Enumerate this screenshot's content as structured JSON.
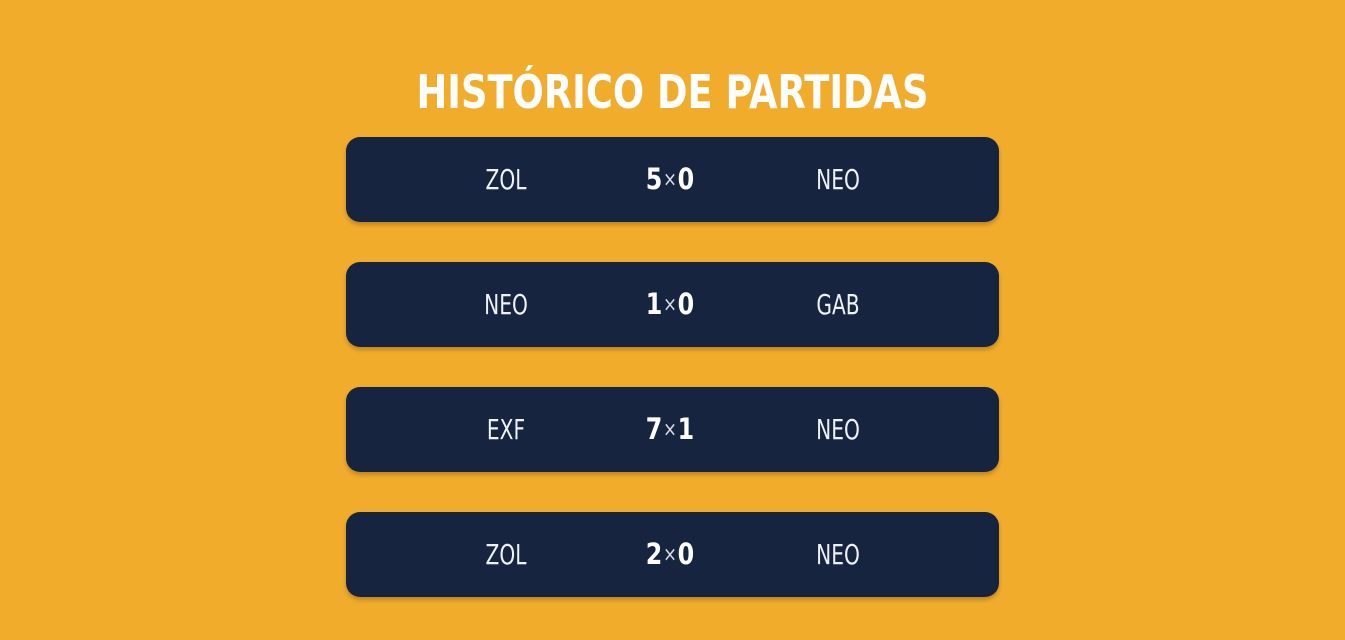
{
  "page": {
    "title": "HISTÓRICO DE PARTIDAS"
  },
  "colors": {
    "background": "#F2AC2C",
    "card": "#172440",
    "text": "#FFFFFF"
  },
  "matches": [
    {
      "home": "ZOL",
      "home_score": "5",
      "separator": "×",
      "away_score": "0",
      "away": "NEO"
    },
    {
      "home": "NEO",
      "home_score": "1",
      "separator": "×",
      "away_score": "0",
      "away": "GAB"
    },
    {
      "home": "EXF",
      "home_score": "7",
      "separator": "×",
      "away_score": "1",
      "away": "NEO"
    },
    {
      "home": "ZOL",
      "home_score": "2",
      "separator": "×",
      "away_score": "0",
      "away": "NEO"
    }
  ]
}
